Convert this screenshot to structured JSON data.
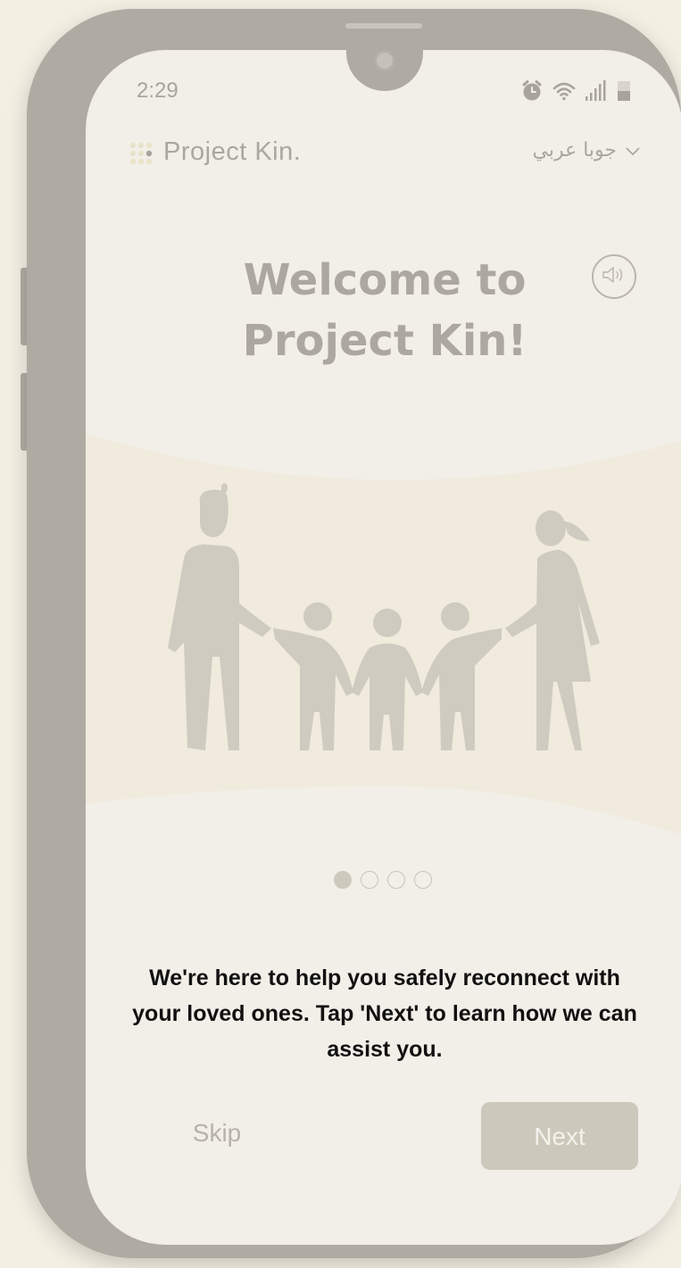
{
  "status_bar": {
    "time": "2:29",
    "icons": [
      "alarm-icon",
      "wifi-icon",
      "signal-icon",
      "battery-icon"
    ]
  },
  "header": {
    "app_name": "Project Kin.",
    "language": "جوبا عربي",
    "logo_icon": "dot-grid-logo-icon",
    "chevron_icon": "chevron-down-icon"
  },
  "onboarding": {
    "title_line1": "Welcome to",
    "title_line2": "Project Kin!",
    "audio_icon": "speaker-icon",
    "illustration_icon": "family-illustration-icon",
    "current_page": 1,
    "total_pages": 4,
    "message": "We're here to help you safely reconnect with your loved ones. Tap 'Next' to learn how we can assist you."
  },
  "actions": {
    "skip_label": "Skip",
    "next_label": "Next"
  },
  "colors": {
    "background": "#f3efe3",
    "phone_frame": "#afaaa2",
    "screen": "#f2efe8",
    "illustration_band": "#f0ebdd",
    "figures": "#d0cbc0",
    "next_button": "#ccc8bb"
  }
}
